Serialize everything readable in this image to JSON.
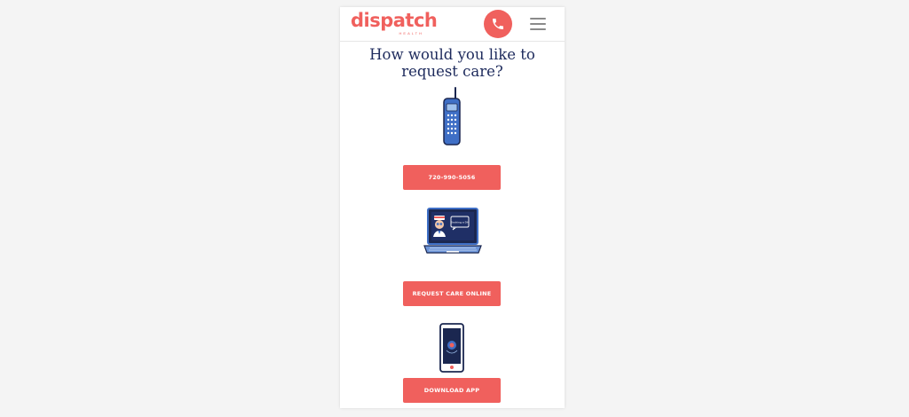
{
  "header": {
    "logo_text": "dispatch",
    "logo_subtext": "HEALTH",
    "call_icon": "phone-icon",
    "menu_icon": "hamburger-icon"
  },
  "main": {
    "title_line1": "How would you like to",
    "title_line2": "request care?",
    "options": [
      {
        "icon": "cordless-phone-icon",
        "button_label": "720-990-5056"
      },
      {
        "icon": "laptop-icon",
        "button_label": "REQUEST CARE ONLINE",
        "screen_text": "Booking a DH"
      },
      {
        "icon": "smartphone-icon",
        "button_label": "DOWNLOAD APP"
      }
    ]
  },
  "colors": {
    "brand": "#f0605d",
    "title": "#1d2a5c",
    "illustration_blue": "#3f6fc6",
    "illustration_navy": "#1b2750"
  }
}
